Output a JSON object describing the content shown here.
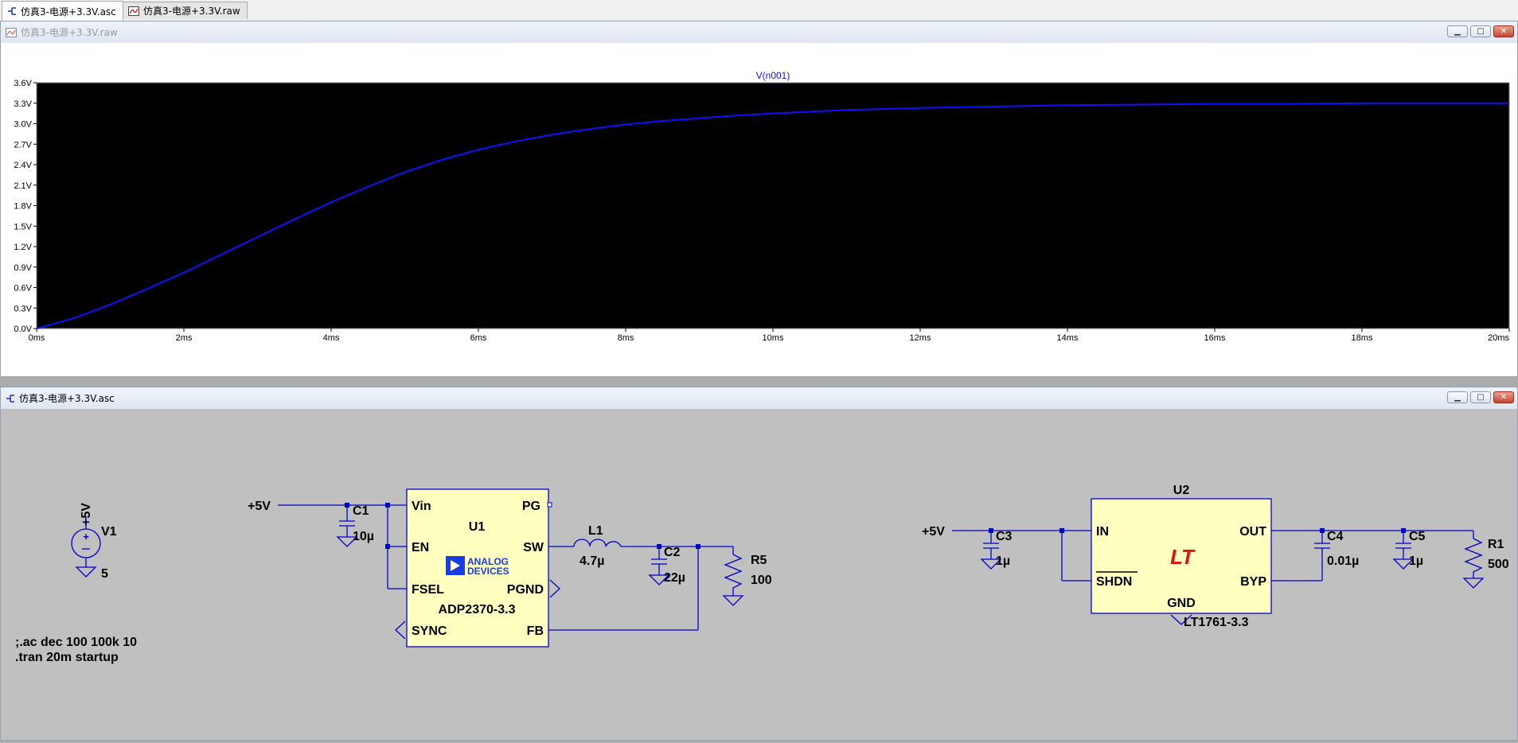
{
  "tabs": [
    {
      "label": "仿真3-电源+3.3V.asc",
      "active": true,
      "icon": "schematic-icon"
    },
    {
      "label": "仿真3-电源+3.3V.raw",
      "active": false,
      "icon": "waveform-icon"
    }
  ],
  "plot_window": {
    "title": "仿真3-电源+3.3V.raw",
    "icon": "waveform-icon",
    "buttons": {
      "minimize": "minimize",
      "maximize": "maximize",
      "close": "close"
    }
  },
  "chart_data": {
    "type": "line",
    "title": "V(n001)",
    "series": [
      {
        "name": "V(n001)",
        "color": "#1010ff",
        "x": [
          0,
          0.5,
          1,
          1.5,
          2,
          2.5,
          3,
          3.5,
          4,
          4.5,
          5,
          5.5,
          6,
          6.5,
          7,
          7.5,
          8,
          8.5,
          9,
          9.5,
          10,
          11,
          12,
          13,
          14,
          15,
          16,
          17,
          18,
          19,
          20
        ],
        "y": [
          0.0,
          0.15,
          0.35,
          0.58,
          0.82,
          1.08,
          1.34,
          1.6,
          1.85,
          2.08,
          2.29,
          2.47,
          2.62,
          2.74,
          2.84,
          2.92,
          2.99,
          3.04,
          3.08,
          3.12,
          3.15,
          3.2,
          3.23,
          3.25,
          3.27,
          3.28,
          3.29,
          3.29,
          3.3,
          3.3,
          3.3
        ]
      }
    ],
    "xlim": [
      0,
      20
    ],
    "ylim": [
      0,
      3.6
    ],
    "x_ticks": [
      "0ms",
      "2ms",
      "4ms",
      "6ms",
      "8ms",
      "10ms",
      "12ms",
      "14ms",
      "16ms",
      "18ms",
      "20ms"
    ],
    "y_ticks": [
      "0.0V",
      "0.3V",
      "0.6V",
      "0.9V",
      "1.2V",
      "1.5V",
      "1.8V",
      "2.1V",
      "2.4V",
      "2.7V",
      "3.0V",
      "3.3V",
      "3.6V"
    ],
    "background": "#000000",
    "grid": false
  },
  "schematic_window": {
    "title": "仿真3-电源+3.3V.asc",
    "icon": "schematic-icon",
    "buttons": {
      "minimize": "minimize",
      "maximize": "maximize",
      "close": "close"
    }
  },
  "schematic": {
    "colors": {
      "wire": "#0000c8",
      "text": "#000000",
      "ic_fill": "#ffffc0",
      "background": "#c0c0c0"
    },
    "v1": {
      "name": "V1",
      "value": "5",
      "net": "+5V"
    },
    "u1": {
      "name": "U1",
      "part": "ADP2370-3.3",
      "pins": {
        "vin": "Vin",
        "pg": "PG",
        "en": "EN",
        "sw": "SW",
        "fsel": "FSEL",
        "pgnd": "PGND",
        "sync": "SYNC",
        "fb": "FB"
      },
      "logo_line1": "ANALOG",
      "logo_line2": "DEVICES"
    },
    "c1": {
      "name": "C1",
      "value": "10µ"
    },
    "l1": {
      "name": "L1",
      "value": "4.7µ"
    },
    "c2": {
      "name": "C2",
      "value": "22µ"
    },
    "r5": {
      "name": "R5",
      "value": "100"
    },
    "u1_input_net": "+5V",
    "u2": {
      "name": "U2",
      "part": "LT1761-3.3",
      "pins": {
        "in": "IN",
        "out": "OUT",
        "shdn": "SHDN",
        "byp": "BYP",
        "gnd": "GND"
      },
      "logo": "LT"
    },
    "u2_input_net": "+5V",
    "c3": {
      "name": "C3",
      "value": "1µ"
    },
    "c4": {
      "name": "C4",
      "value": "0.01µ"
    },
    "c5": {
      "name": "C5",
      "value": "1µ"
    },
    "r1": {
      "name": "R1",
      "value": "500"
    },
    "directives": [
      ";.ac dec 100 100k 10",
      ".tran 20m startup"
    ]
  }
}
